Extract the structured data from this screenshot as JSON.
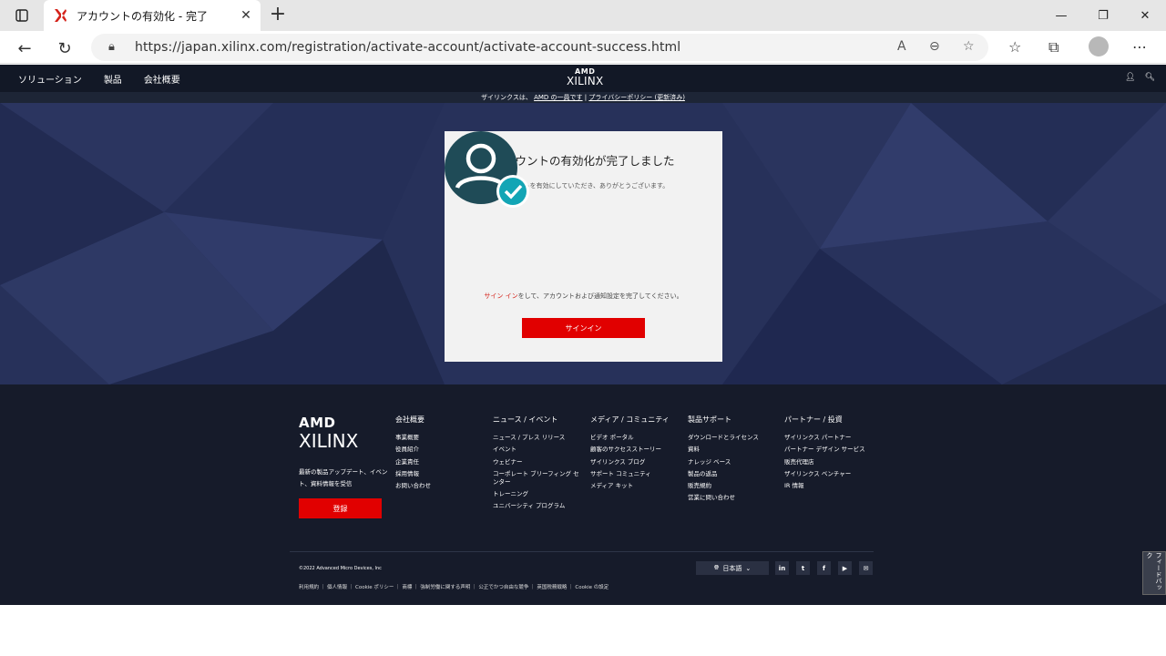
{
  "browser": {
    "tab_title": "アカウントの有効化 - 完了",
    "new_tab_symbol": "+",
    "url": "https://japan.xilinx.com/registration/activate-account/activate-account-success.html"
  },
  "header": {
    "nav": [
      "ソリューション",
      "製品",
      "会社概要"
    ],
    "logo_amd": "AMD",
    "logo_xilinx": "XILINX",
    "notice_prefix": "ザイリンクスは、",
    "notice_link1": "AMD の一員です",
    "notice_sep": "|",
    "notice_link2": "プライバシーポリシー (更新済み)"
  },
  "card": {
    "title": "アカウントの有効化が完了しました",
    "subtitle": "アカウントを有効にしていただき、ありがとうございます。",
    "msg_link": "サイン イン",
    "msg_rest": "をして、アカウントおよび通知設定を完了してください。",
    "signin_label": "サインイン"
  },
  "footer": {
    "logo_amd": "AMD",
    "logo_xilinx": "XILINX",
    "desc": "最新の製品アップデート、イベント、資料情報を受信",
    "register_label": "登録",
    "columns": [
      {
        "heading": "会社概要",
        "items": [
          "事業概要",
          "役員紹介",
          "企業責任",
          "採用情報",
          "お問い合わせ"
        ]
      },
      {
        "heading": "ニュース / イベント",
        "items": [
          "ニュース / プレス リリース",
          "イベント",
          "ウェビナー",
          "コーポレート ブリーフィング センター",
          "トレーニング",
          "ユニバーシティ プログラム"
        ]
      },
      {
        "heading": "メディア / コミュニティ",
        "items": [
          "ビデオ ポータル",
          "顧客のサクセスストーリー",
          "ザイリンクス ブログ",
          "サポート コミュニティ",
          "メディア キット"
        ]
      },
      {
        "heading": "製品サポート",
        "items": [
          "ダウンロードとライセンス",
          "資料",
          "ナレッジ ベース",
          "製品の返品",
          "販売規約",
          "営業に問い合わせ"
        ]
      },
      {
        "heading": "パートナー / 投資",
        "items": [
          "ザイリンクス パートナー",
          "パートナー デザイン サービス",
          "販売代理店",
          "ザイリンクス ベンチャー",
          "IR 情報"
        ]
      }
    ],
    "copyright": "©2022 Advanced Micro Devices, Inc",
    "legal_links": "利用規約 ｜ 個人情報 ｜ Cookie ポリシー ｜ 商標 ｜ 強制労働に関する声明 ｜ 公正でかつ自由な競争 ｜ 英国税務戦略 ｜ Cookie の設定",
    "language": "日本語",
    "social": [
      "in",
      "t",
      "f",
      "▶",
      "✉"
    ],
    "feedback": "フィードバック"
  }
}
